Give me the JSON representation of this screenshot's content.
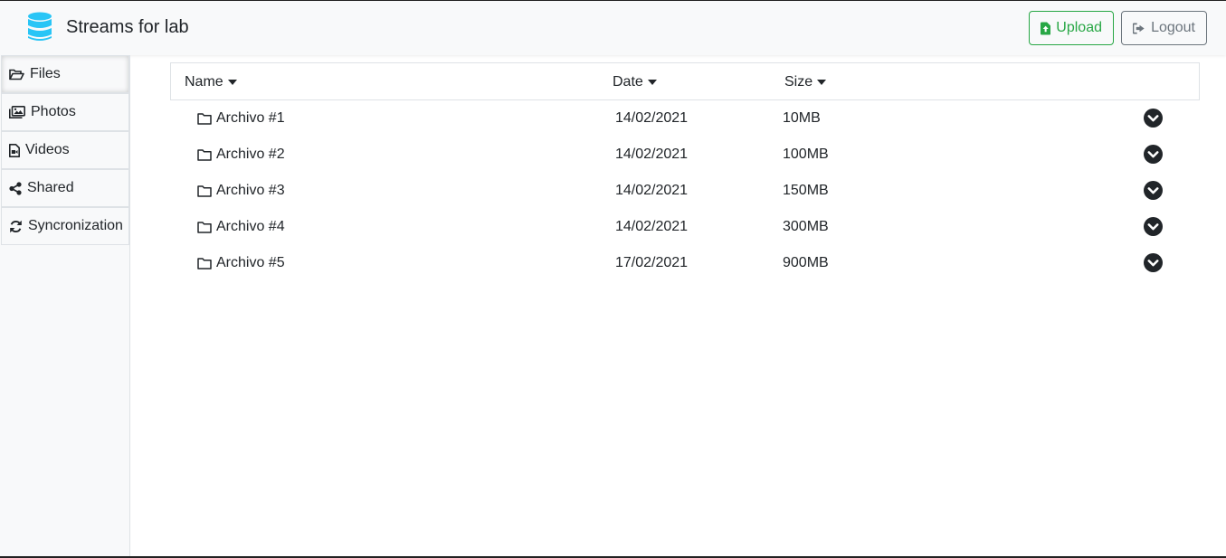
{
  "header": {
    "title": "Streams for lab",
    "logo_icon": "database-icon",
    "upload_label": "Upload",
    "logout_label": "Logout",
    "colors": {
      "logo": "#29c5f6",
      "upload": "#28a745",
      "logout": "#6c757d"
    }
  },
  "sidebar": {
    "items": [
      {
        "label": "Files",
        "icon": "folder-open-icon",
        "active": true
      },
      {
        "label": "Photos",
        "icon": "images-icon",
        "active": false
      },
      {
        "label": "Videos",
        "icon": "file-video-icon",
        "active": false
      },
      {
        "label": "Shared",
        "icon": "share-icon",
        "active": false
      },
      {
        "label": "Syncronization",
        "icon": "sync-icon",
        "active": false
      }
    ]
  },
  "table": {
    "columns": [
      "Name",
      "Date",
      "Size"
    ],
    "rows": [
      {
        "name": "Archivo #1",
        "date": "14/02/2021",
        "size": "10MB"
      },
      {
        "name": "Archivo #2",
        "date": "14/02/2021",
        "size": "100MB"
      },
      {
        "name": "Archivo #3",
        "date": "14/02/2021",
        "size": "150MB"
      },
      {
        "name": "Archivo #4",
        "date": "14/02/2021",
        "size": "300MB"
      },
      {
        "name": "Archivo #5",
        "date": "17/02/2021",
        "size": "900MB"
      }
    ]
  }
}
